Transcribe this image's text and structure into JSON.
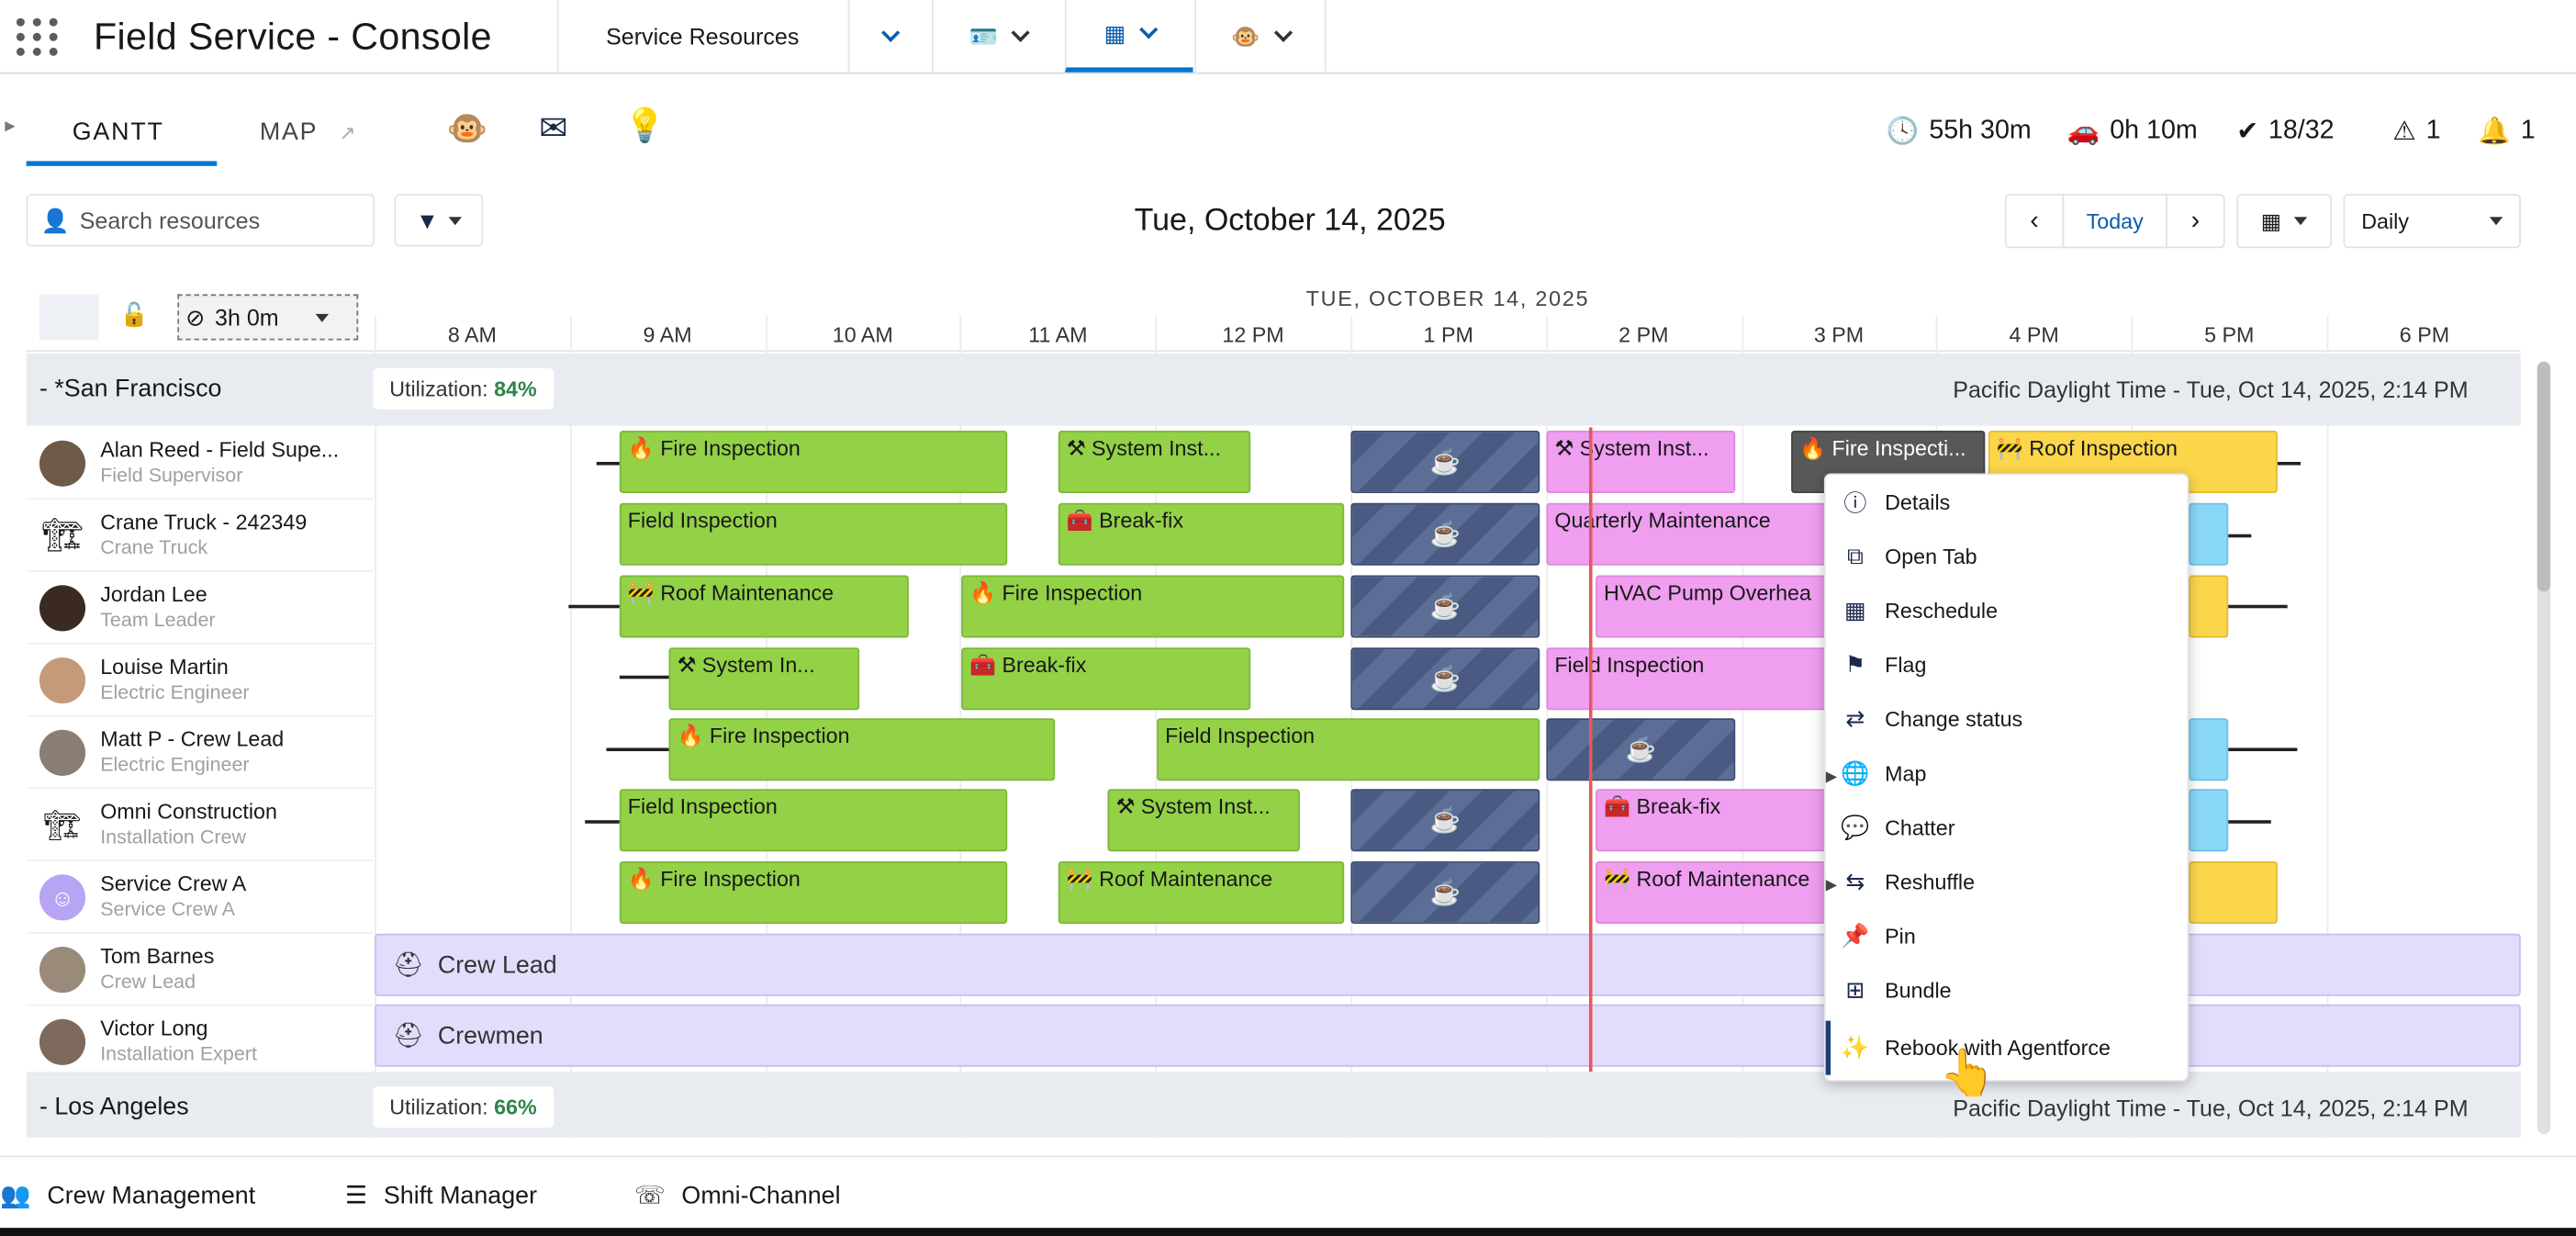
{
  "header": {
    "app_title": "Field Service - Console",
    "tabs": [
      {
        "label": "Service Resources"
      },
      {
        "icon": "chevron-down-icon"
      },
      {
        "icon": "id-card-icon"
      },
      {
        "icon": "calendar-icon"
      },
      {
        "icon": "astro-icon"
      }
    ]
  },
  "subtabs": {
    "gantt": "GANTT",
    "map": "MAP"
  },
  "metrics": {
    "work_time": "55h 30m",
    "travel_time": "0h 10m",
    "completed": "18/32",
    "warnings": "1",
    "alerts": "1"
  },
  "toolbar": {
    "search_placeholder": "Search resources",
    "date_title": "Tue, October 14, 2025",
    "today": "Today",
    "view": "Daily"
  },
  "gantt": {
    "duration": "3h 0m",
    "date_header": "TUE, OCTOBER 14, 2025",
    "hours": [
      "8 AM",
      "9 AM",
      "10 AM",
      "11 AM",
      "12 PM",
      "1 PM",
      "2 PM",
      "3 PM",
      "4 PM",
      "5 PM",
      "6 PM"
    ],
    "territories": [
      {
        "name": "- *San Francisco",
        "utilization_label": "Utilization:",
        "utilization": "84%",
        "timezone": "Pacific Daylight Time - Tue, Oct 14, 2025, 2:14 PM"
      },
      {
        "name": "- Los Angeles",
        "utilization_label": "Utilization:",
        "utilization": "66%",
        "timezone": "Pacific Daylight Time - Tue, Oct 14, 2025, 2:14 PM"
      }
    ],
    "resources": [
      {
        "name": "Alan Reed - Field Supe...",
        "role": "Field Supervisor"
      },
      {
        "name": "Crane Truck - 242349",
        "role": "Crane Truck"
      },
      {
        "name": "Jordan Lee",
        "role": "Team Leader"
      },
      {
        "name": "Louise Martin",
        "role": "Electric Engineer"
      },
      {
        "name": "Matt P - Crew Lead",
        "role": "Electric Engineer"
      },
      {
        "name": "Omni Construction",
        "role": "Installation Crew"
      },
      {
        "name": "Service Crew A",
        "role": "Service Crew A"
      },
      {
        "name": "Tom Barnes",
        "role": "Crew Lead"
      },
      {
        "name": "Victor Long",
        "role": "Installation Expert"
      }
    ],
    "appointments": {
      "fire_inspection": "🔥 Fire Inspection",
      "system_inst": "⚒ System Inst...",
      "system_inst_full": "⚒ System Inst...",
      "system_in": "⚒ System In...",
      "fire_inspecti": "🔥 Fire Inspecti...",
      "roof_inspection": "🚧 Roof Inspection",
      "field_inspection": "Field Inspection",
      "break_fix": "🧰 Break-fix",
      "quarterly_maintenance": "Quarterly Maintenance",
      "roof_maintenance": "🚧 Roof Maintenance",
      "hvac": "HVAC Pump Overhea",
      "roof_maintenance_cut": "🚧 Roof Maintenance"
    },
    "crew_labels": [
      "Crew Lead",
      "Crewmen"
    ]
  },
  "context_menu": [
    {
      "label": "Details",
      "icon": "info-icon"
    },
    {
      "label": "Open Tab",
      "icon": "new-window-icon"
    },
    {
      "label": "Reschedule",
      "icon": "calendar-icon"
    },
    {
      "label": "Flag",
      "icon": "flag-icon"
    },
    {
      "label": "Change status",
      "icon": "change-status-icon"
    },
    {
      "label": "Map",
      "icon": "globe-icon"
    },
    {
      "label": "Chatter",
      "icon": "chat-icon"
    },
    {
      "label": "Reshuffle",
      "icon": "reshuffle-icon"
    },
    {
      "label": "Pin",
      "icon": "pin-icon"
    },
    {
      "label": "Bundle",
      "icon": "bundle-icon"
    },
    {
      "label": "Rebook with Agentforce",
      "icon": "magic-wand-icon"
    }
  ],
  "utility_bar": [
    {
      "label": "Crew Management"
    },
    {
      "label": "Shift Manager"
    },
    {
      "label": "Omni-Channel"
    }
  ]
}
